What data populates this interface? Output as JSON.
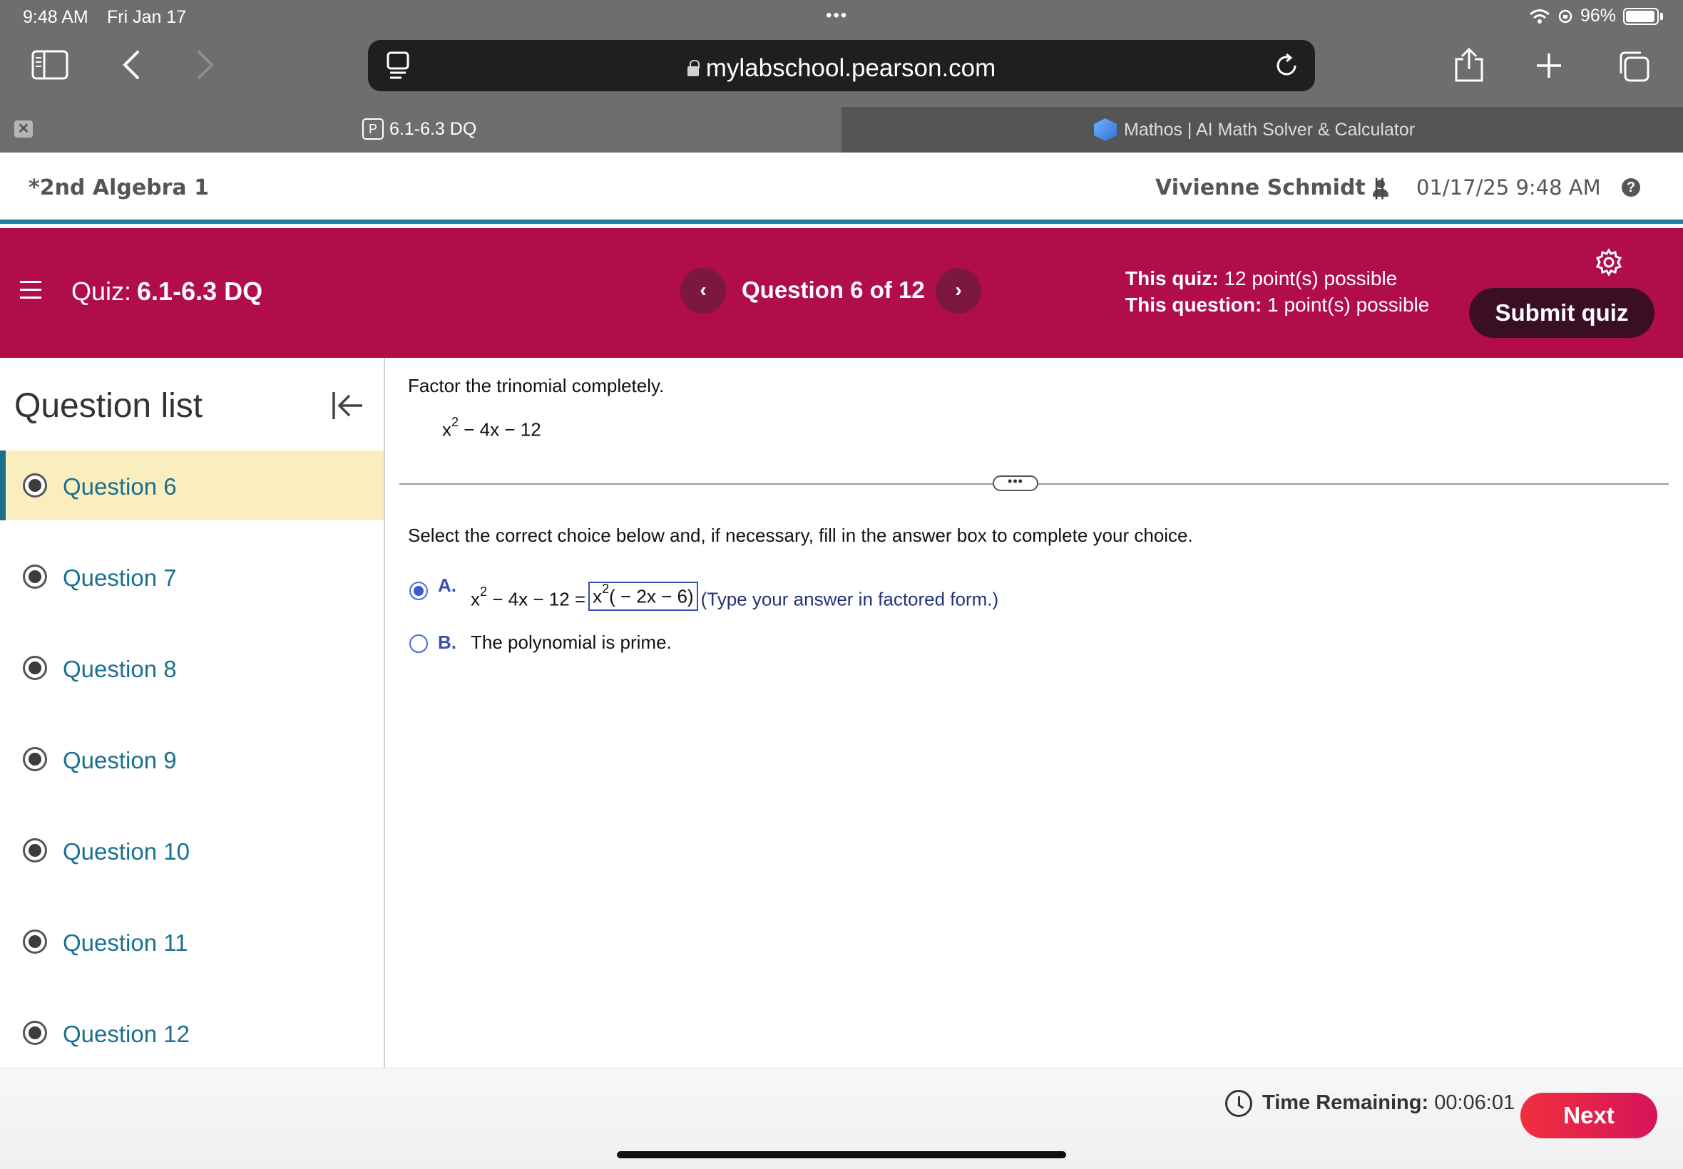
{
  "status_bar": {
    "time": "9:48 AM",
    "date": "Fri Jan 17",
    "dots": "•••",
    "battery": "96%"
  },
  "browser": {
    "url": "mylabschool.pearson.com",
    "tabs": [
      {
        "label": "6.1-6.3 DQ",
        "favicon": "P",
        "active": true
      },
      {
        "label": "Mathos | AI Math Solver & Calculator",
        "active": false
      }
    ],
    "tab_close": "✕"
  },
  "course_header": {
    "title": "*2nd Algebra 1",
    "user": "Vivienne Schmidt",
    "separator": "||",
    "datetime": "01/17/25 9:48 AM",
    "help": "?"
  },
  "quiz_banner": {
    "quiz_prefix": "Quiz:",
    "quiz_name": "6.1-6.3 DQ",
    "prev": "‹",
    "next": "›",
    "question_counter": "Question 6 of 12",
    "quiz_points_label": "This quiz:",
    "quiz_points_value": "12 point(s) possible",
    "question_points_label": "This question:",
    "question_points_value": "1 point(s) possible",
    "submit_label": "Submit quiz"
  },
  "sidebar": {
    "title": "Question list",
    "items": [
      {
        "label": "Question 6",
        "active": true
      },
      {
        "label": "Question 7"
      },
      {
        "label": "Question 8"
      },
      {
        "label": "Question 9"
      },
      {
        "label": "Question 10"
      },
      {
        "label": "Question 11"
      },
      {
        "label": "Question 12"
      }
    ]
  },
  "question": {
    "instruction": "Factor the trinomial completely.",
    "expression_base": "x",
    "expression_exp": "2",
    "expression_rest": " − 4x − 12",
    "divider_handle": "•••",
    "select_prompt": "Select the correct choice below and, if necessary, fill in the answer box to complete your choice.",
    "choice_a": {
      "letter": "A.",
      "lhs_base": "x",
      "lhs_exp": "2",
      "lhs_rest": " − 4x − 12 =",
      "answer_base": "x",
      "answer_exp": "2",
      "answer_rest": "( − 2x − 6)",
      "hint": "(Type your answer in factored form.)",
      "selected": true
    },
    "choice_b": {
      "letter": "B.",
      "text": "The polynomial is prime.",
      "selected": false
    }
  },
  "footer": {
    "time_label": "Time Remaining:",
    "time_value": "00:06:01",
    "next_label": "Next"
  }
}
